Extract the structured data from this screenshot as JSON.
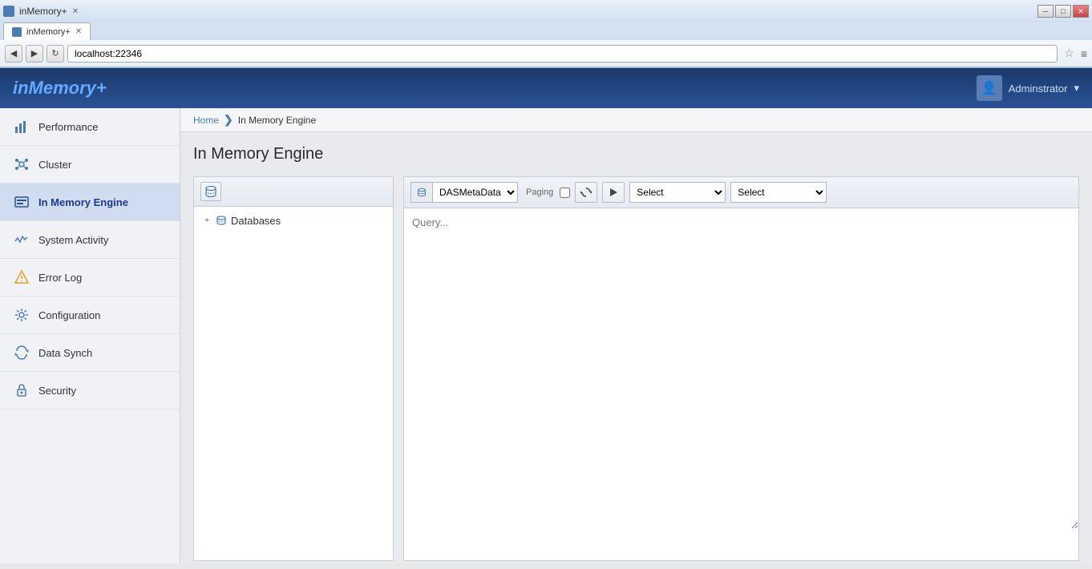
{
  "browser": {
    "tab_title": "inMemory+",
    "address": "localhost:22346",
    "back_label": "◀",
    "forward_label": "▶",
    "refresh_label": "↻",
    "star_label": "☆",
    "menu_label": "≡",
    "win_min": "─",
    "win_max": "□",
    "win_close": "✕"
  },
  "app": {
    "logo": "inMemory+",
    "user_label": "Adminstrator",
    "user_dropdown": "▾"
  },
  "breadcrumb": {
    "home": "Home",
    "separator": "❯",
    "current": "In Memory Engine"
  },
  "page": {
    "title": "In Memory Engine"
  },
  "sidebar": {
    "items": [
      {
        "id": "performance",
        "label": "Performance",
        "icon": "⊞"
      },
      {
        "id": "cluster",
        "label": "Cluster",
        "icon": "⬡"
      },
      {
        "id": "in-memory-engine",
        "label": "In Memory Engine",
        "icon": "⊟"
      },
      {
        "id": "system-activity",
        "label": "System Activity",
        "icon": "∿"
      },
      {
        "id": "error-log",
        "label": "Error Log",
        "icon": "⚠"
      },
      {
        "id": "configuration",
        "label": "Configuration",
        "icon": "⚙"
      },
      {
        "id": "data-synch",
        "label": "Data Synch",
        "icon": "⟳"
      },
      {
        "id": "security",
        "label": "Security",
        "icon": "🔒"
      }
    ]
  },
  "tree": {
    "toolbar_icon": "🗄",
    "items": [
      {
        "label": "Databases",
        "icon": "📊",
        "expanded": false
      }
    ]
  },
  "query": {
    "db_icon": "📊",
    "db_value": "DASMetaData",
    "paging_label": "Paging",
    "placeholder": "Query...",
    "select1_options": [
      "Select"
    ],
    "select1_default": "Select",
    "select2_options": [
      "Select"
    ],
    "select2_default": "Select",
    "refresh_icon": "↻",
    "play_icon": "▶"
  }
}
